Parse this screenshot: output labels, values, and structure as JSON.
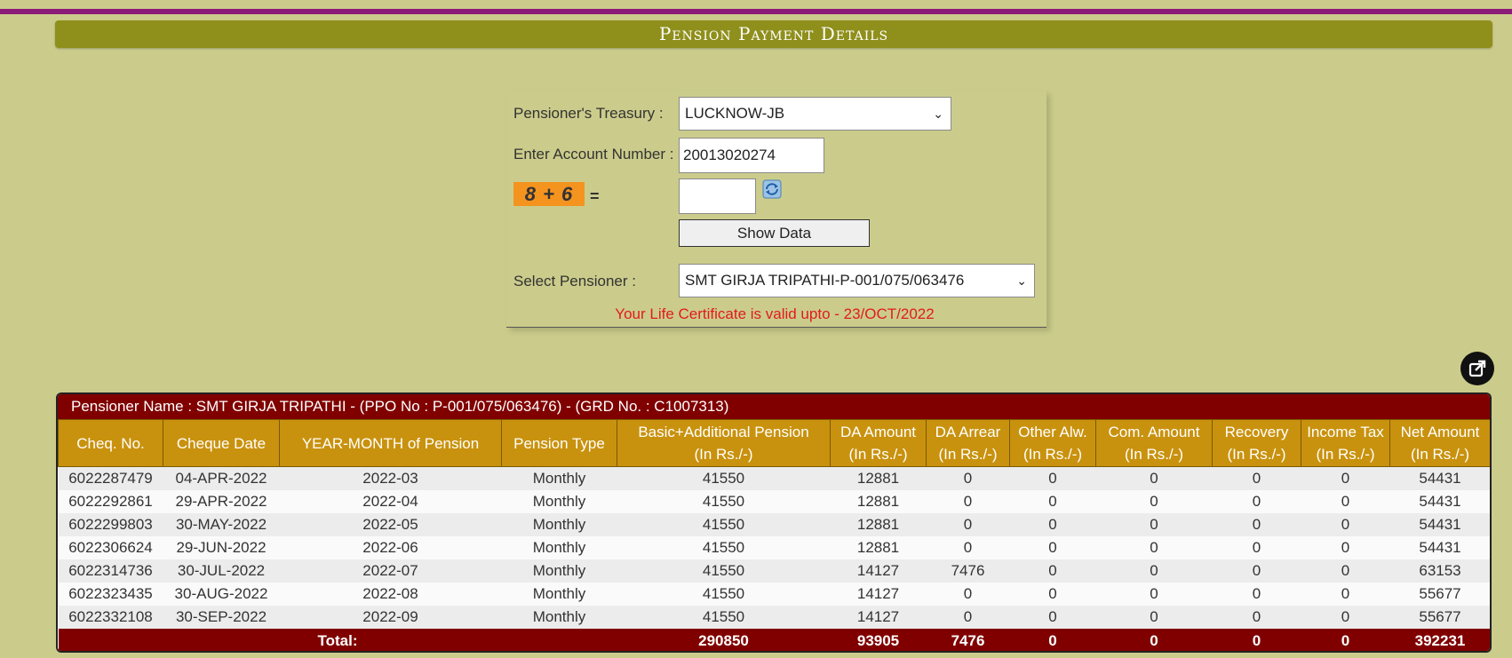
{
  "page": {
    "title": "Pension Payment Details"
  },
  "form": {
    "treasury_label": "Pensioner's Treasury :",
    "treasury_value": "LUCKNOW-JB",
    "account_label": "Enter Account Number :",
    "account_value": "20013020274",
    "captcha_text": "8 + 6",
    "captcha_equals": "=",
    "captcha_answer": "",
    "show_button": "Show Data",
    "pensioner_label": "Select Pensioner :",
    "pensioner_value": "SMT GIRJA TRIPATHI-P-001/075/063476",
    "life_certificate": "Your Life Certificate is valid upto - 23/OCT/2022"
  },
  "table": {
    "pensioner_info": "Pensioner Name : SMT GIRJA TRIPATHI - (PPO No : P-001/075/063476) - (GRD No. : C1007313)",
    "headers": [
      [
        "Cheq. No."
      ],
      [
        "Cheque Date"
      ],
      [
        "YEAR-MONTH of Pension"
      ],
      [
        "Pension Type"
      ],
      [
        "Basic+Additional Pension",
        "(In Rs./-)"
      ],
      [
        "DA Amount",
        "(In Rs./-)"
      ],
      [
        "DA Arrear",
        "(In Rs./-)"
      ],
      [
        "Other Alw.",
        "(In Rs./-)"
      ],
      [
        "Com. Amount",
        "(In Rs./-)"
      ],
      [
        "Recovery",
        "(In Rs./-)"
      ],
      [
        "Income Tax",
        "(In Rs./-)"
      ],
      [
        "Net Amount",
        "(In Rs./-)"
      ]
    ],
    "rows": [
      [
        "6022287479",
        "04-APR-2022",
        "2022-03",
        "Monthly",
        "41550",
        "12881",
        "0",
        "0",
        "0",
        "0",
        "0",
        "54431"
      ],
      [
        "6022292861",
        "29-APR-2022",
        "2022-04",
        "Monthly",
        "41550",
        "12881",
        "0",
        "0",
        "0",
        "0",
        "0",
        "54431"
      ],
      [
        "6022299803",
        "30-MAY-2022",
        "2022-05",
        "Monthly",
        "41550",
        "12881",
        "0",
        "0",
        "0",
        "0",
        "0",
        "54431"
      ],
      [
        "6022306624",
        "29-JUN-2022",
        "2022-06",
        "Monthly",
        "41550",
        "12881",
        "0",
        "0",
        "0",
        "0",
        "0",
        "54431"
      ],
      [
        "6022314736",
        "30-JUL-2022",
        "2022-07",
        "Monthly",
        "41550",
        "14127",
        "7476",
        "0",
        "0",
        "0",
        "0",
        "63153"
      ],
      [
        "6022323435",
        "30-AUG-2022",
        "2022-08",
        "Monthly",
        "41550",
        "14127",
        "0",
        "0",
        "0",
        "0",
        "0",
        "55677"
      ],
      [
        "6022332108",
        "30-SEP-2022",
        "2022-09",
        "Monthly",
        "41550",
        "14127",
        "0",
        "0",
        "0",
        "0",
        "0",
        "55677"
      ]
    ],
    "total": {
      "label": "Total:",
      "values": [
        "290850",
        "93905",
        "7476",
        "0",
        "0",
        "0",
        "0",
        "392231"
      ]
    }
  },
  "colors": {
    "background": "#cbcc8b",
    "title_bar": "#8f8f1c",
    "header": "#c9920e",
    "dark_red": "#800000",
    "captcha": "#f5931f",
    "alert_text": "#e21b1b"
  },
  "icons": {
    "refresh": "refresh-icon",
    "external": "external-link-icon"
  }
}
